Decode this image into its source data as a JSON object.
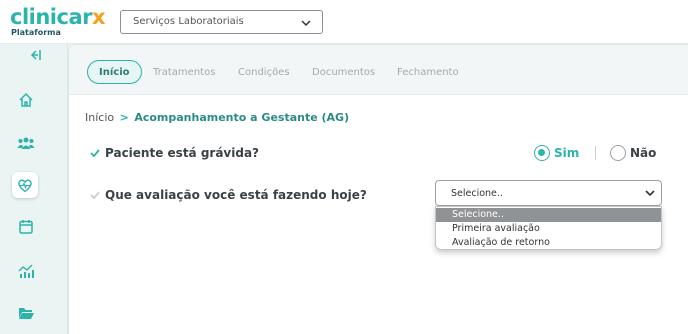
{
  "header": {
    "logo_main": "clinicar",
    "logo_accent": "x",
    "logo_sub": "Plataforma",
    "service_select_value": "Serviços Laboratoriais"
  },
  "sidebar": {
    "items": [
      {
        "icon": "home-icon"
      },
      {
        "icon": "users-icon"
      },
      {
        "icon": "heart-monitor-icon",
        "active": true
      },
      {
        "icon": "calendar-icon"
      },
      {
        "icon": "chart-icon"
      },
      {
        "icon": "folder-icon"
      }
    ]
  },
  "tabs": [
    {
      "label": "Início",
      "active": true
    },
    {
      "label": "Tratamentos"
    },
    {
      "label": "Condições"
    },
    {
      "label": "Documentos"
    },
    {
      "label": "Fechamento"
    }
  ],
  "breadcrumb": {
    "root": "Início",
    "separator": ">",
    "current": "Acompanhamento a Gestante (AG)"
  },
  "questions": {
    "pregnant": {
      "label": "Paciente está grávida?",
      "option_yes": "Sim",
      "option_no": "Não",
      "selected": "Sim"
    },
    "evaluation": {
      "label": "Que avaliação você está fazendo hoje?",
      "select_value": "Selecione..",
      "options": [
        "Selecione..",
        "Primeira avaliação",
        "Avaliação de retorno"
      ]
    }
  },
  "colors": {
    "accent": "#2bb3ac",
    "logo_accent": "#f5a21c",
    "sidebar_bg": "#e9f4f3"
  }
}
